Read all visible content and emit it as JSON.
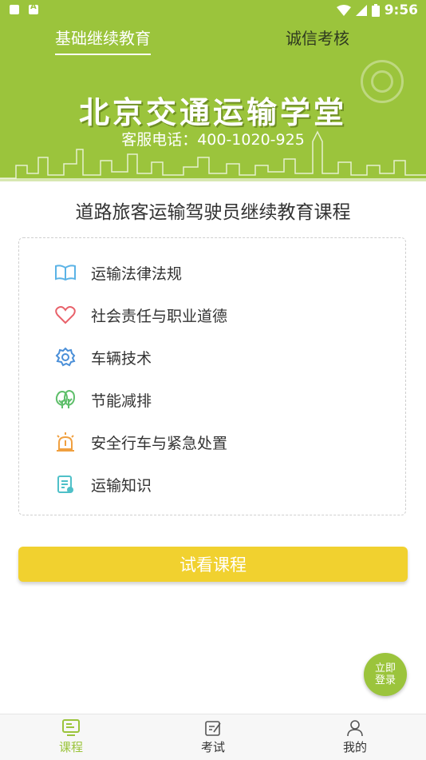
{
  "status_bar": {
    "time": "9:56"
  },
  "header": {
    "tabs": [
      {
        "label": "基础继续教育"
      },
      {
        "label": "诚信考核"
      }
    ],
    "school_name": "北京交通运输学堂",
    "hotline": "客服电话：400-1020-925"
  },
  "course": {
    "title": "道路旅客运输驾驶员继续教育课程",
    "modules": [
      {
        "label": "运输法律法规",
        "icon": "book-icon",
        "color": "#5bb3e6"
      },
      {
        "label": "社会责任与职业道德",
        "icon": "heart-icon",
        "color": "#e8616a"
      },
      {
        "label": "车辆技术",
        "icon": "gear-icon",
        "color": "#4a8fd8"
      },
      {
        "label": "节能减排",
        "icon": "tree-icon",
        "color": "#5fbf6b"
      },
      {
        "label": "安全行车与紧急处置",
        "icon": "alarm-icon",
        "color": "#f0a040"
      },
      {
        "label": "运输知识",
        "icon": "document-icon",
        "color": "#4fc0c8"
      }
    ]
  },
  "trial_button": {
    "label": "试看课程",
    "color": "#f1d12f"
  },
  "login_fab": {
    "line1": "立即",
    "line2": "登录"
  },
  "bottom_nav": {
    "items": [
      {
        "label": "课程",
        "icon": "monitor-icon"
      },
      {
        "label": "考试",
        "icon": "exam-edit-icon"
      },
      {
        "label": "我的",
        "icon": "user-icon"
      }
    ],
    "active_color": "#9bc43c"
  },
  "theme": {
    "brand_green": "#9bc43c"
  }
}
